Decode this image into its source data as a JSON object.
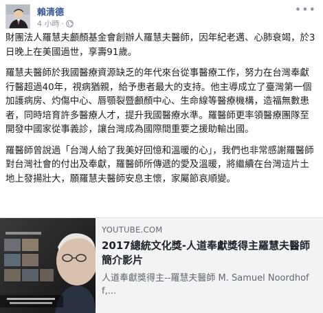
{
  "post": {
    "author": "賴清德",
    "time": "4 小時",
    "separator": "·",
    "privacy_icon": "globe-icon",
    "more_icon": "more-icon",
    "paragraphs": [
      "財團法人羅慧夫顱顏基金會創辦人羅慧夫醫師，因年紀老邁、心肺衰竭，於3日晚上在美國過世，享壽91歲。",
      "羅慧夫醫師於我國醫療資源缺乏的年代來台從事醫療工作，努力在台灣奉獻行醫超過40年，視病猶親，給予患者最大的支持。他主導成立了臺灣第一個加護病房、灼傷中心、唇顎裂暨顱顏中心、生命線等醫療機構，造福無數患者，同時培育許多醫療人才，提升我國醫療水準。羅醫師更率領醫療團隊至開發中國家從事義診，讓台灣成為國際間重要之援助輸出國。",
      "羅醫師曾說過「台灣人給了我美好回憶和溫暖的心」，我們也非常感謝羅醫師對台灣社會的付出及奉獻，羅醫師所傳遞的愛及溫暖，將繼續在台灣這片土地上發揚壯大，願羅慧夫醫師安息主懷，家屬節哀順變。"
    ]
  },
  "link": {
    "domain": "YOUTUBE.COM",
    "title": "2017總統文化獎-人道奉獻獎得主羅慧夫醫師簡介影片",
    "description": "人道奉獻獎得主--羅慧夫醫師 M. Samuel Noordhoff,..."
  },
  "colors": {
    "author_link": "#385898",
    "meta_gray": "#90949c",
    "card_bg": "#f2f3f5"
  }
}
